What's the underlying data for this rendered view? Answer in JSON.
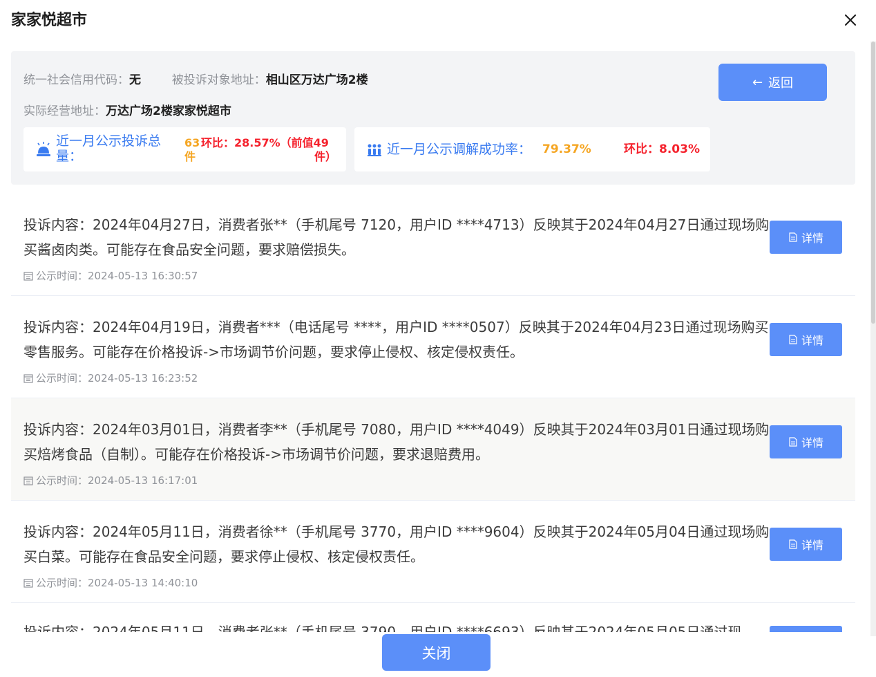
{
  "title": "家家悦超市",
  "info": {
    "credit_code_label": "统一社会信用代码：",
    "credit_code_value": "无",
    "address_label": "被投诉对象地址：",
    "address_value": "相山区万达广场2楼",
    "actual_address_label": "实际经营地址：",
    "actual_address_value": "万达广场2楼家家悦超市",
    "back_label": "返回"
  },
  "stats": {
    "complaints_label": "近一月公示投诉总量：",
    "complaints_count": "63",
    "complaints_unit": "件",
    "complaints_compare": "环比：28.57%（前值49",
    "complaints_prev_tail": "件）",
    "mediation_label": "近一月公示调解成功率：",
    "mediation_rate": "79.37%",
    "mediation_compare": "环比：8.03%"
  },
  "items": [
    {
      "content": "投诉内容：2024年04月27日，消费者张**（手机尾号 7120，用户ID ****4713）反映其于2024年04月27日通过现场购买酱卤肉类。可能存在食品安全问题，要求赔偿损失。",
      "time": "公示时间：2024-05-13 16:30:57",
      "detail_label": "详情"
    },
    {
      "content": "投诉内容：2024年04月19日，消费者***（电话尾号 ****，用户ID ****0507）反映其于2024年04月23日通过现场购买零售服务。可能存在价格投诉->市场调节价问题，要求停止侵权、核定侵权责任。",
      "time": "公示时间：2024-05-13 16:23:52",
      "detail_label": "详情"
    },
    {
      "content": "投诉内容：2024年03月01日，消费者李**（手机尾号 7080，用户ID ****4049）反映其于2024年03月01日通过现场购买焙烤食品（自制）。可能存在价格投诉->市场调节价问题，要求退赔费用。",
      "time": "公示时间：2024-05-13 16:17:01",
      "detail_label": "详情"
    },
    {
      "content": "投诉内容：2024年05月11日，消费者徐**（手机尾号 3770，用户ID ****9604）反映其于2024年05月04日通过现场购买白菜。可能存在食品安全问题，要求停止侵权、核定侵权责任。",
      "time": "公示时间：2024-05-13 14:40:10",
      "detail_label": "详情"
    },
    {
      "content": "投诉内容：2024年05月11日，消费者张**（手机尾号 3790，用户ID ****6693）反映其于2024年05月05日通过现",
      "time": "",
      "detail_label": ""
    }
  ],
  "close_label": "关闭",
  "colors": {
    "primary": "#5b8ff9",
    "link_blue": "#3a7bf0",
    "orange": "#f5a623",
    "red": "#f5222d"
  }
}
